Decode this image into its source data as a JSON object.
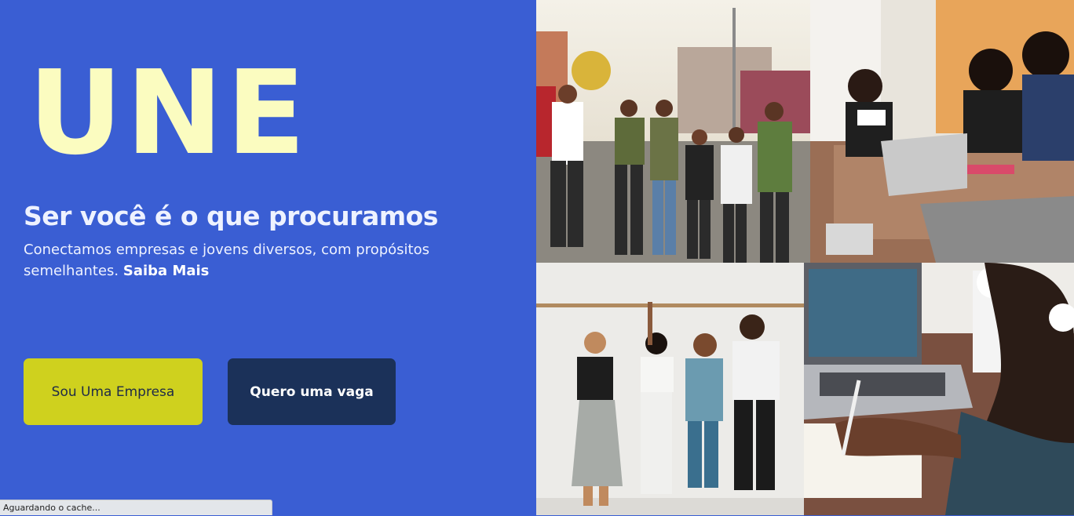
{
  "hero": {
    "brand": "UNE",
    "headline": "Ser você é o que procuramos",
    "description": "Conectamos empresas e jovens diversos, com propósitos semelhantes.",
    "learn_more": "Saiba Mais"
  },
  "buttons": {
    "company": "Sou Uma Empresa",
    "job": "Quero uma vaga"
  },
  "status_bar": {
    "text": "Aguardando o cache..."
  },
  "colors": {
    "background": "#3a5ed3",
    "brand": "#fbfcc0",
    "company_button": "#cfd11e",
    "job_button": "#1b3159"
  }
}
